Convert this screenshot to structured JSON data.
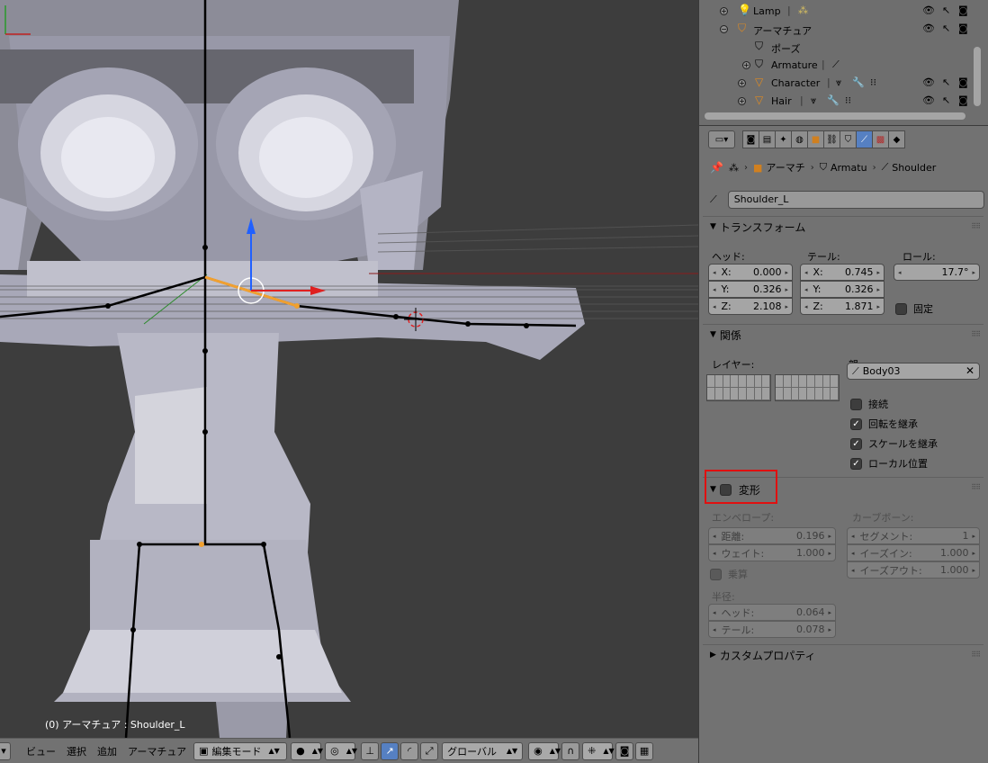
{
  "viewport": {
    "status_text": "(0) アーマチュア : Shoulder_L"
  },
  "header": {
    "menu_view": "ビュー",
    "menu_select": "選択",
    "menu_add": "追加",
    "menu_armature": "アーマチュア",
    "mode": "編集モード",
    "orientation": "グローバル"
  },
  "outliner": {
    "rows": [
      {
        "label": "Lamp"
      },
      {
        "label": "アーマチュア"
      },
      {
        "label": "ポーズ"
      },
      {
        "label": "Armature"
      },
      {
        "label": "Character"
      },
      {
        "label": "Hair"
      }
    ]
  },
  "breadcrumb": {
    "object": "アーマチ",
    "armature": "Armatu",
    "bone": "Shoulder"
  },
  "bone_name": "Shoulder_L",
  "transform": {
    "title": "トランスフォーム",
    "head_label": "ヘッド:",
    "tail_label": "テール:",
    "roll_label": "ロール:",
    "head": {
      "x": "0.000",
      "y": "0.326",
      "z": "2.108"
    },
    "tail": {
      "x": "0.745",
      "y": "0.326",
      "z": "1.871"
    },
    "roll": "17.7°",
    "lock_label": "固定",
    "axis_x": "X:",
    "axis_y": "Y:",
    "axis_z": "Z:"
  },
  "relations": {
    "title": "関係",
    "layers_label": "レイヤー:",
    "parent_label": "親:",
    "parent_value": "Body03",
    "connected": "接続",
    "inherit_rotation": "回転を継承",
    "inherit_scale": "スケールを継承",
    "local_location": "ローカル位置"
  },
  "deform": {
    "title": "変形",
    "envelope_label": "エンベロープ:",
    "distance_label": "距離:",
    "distance": "0.196",
    "weight_label": "ウェイト:",
    "weight": "1.000",
    "multiply_label": "乗算",
    "radius_label": "半径:",
    "radius_head_label": "ヘッド:",
    "radius_head": "0.064",
    "radius_tail_label": "テール:",
    "radius_tail": "0.078",
    "curved_label": "カーブボーン:",
    "segments_label": "セグメント:",
    "segments": "1",
    "ease_in_label": "イーズイン:",
    "ease_in": "1.000",
    "ease_out_label": "イーズアウト:",
    "ease_out": "1.000"
  },
  "custom_props": {
    "title": "カスタムプロパティ"
  },
  "colors": {
    "background": "#3d3d3d",
    "panel": "#727272",
    "accent": "#5680c2",
    "highlight_box": "#e01010",
    "selected_bone": "#f0a030"
  }
}
